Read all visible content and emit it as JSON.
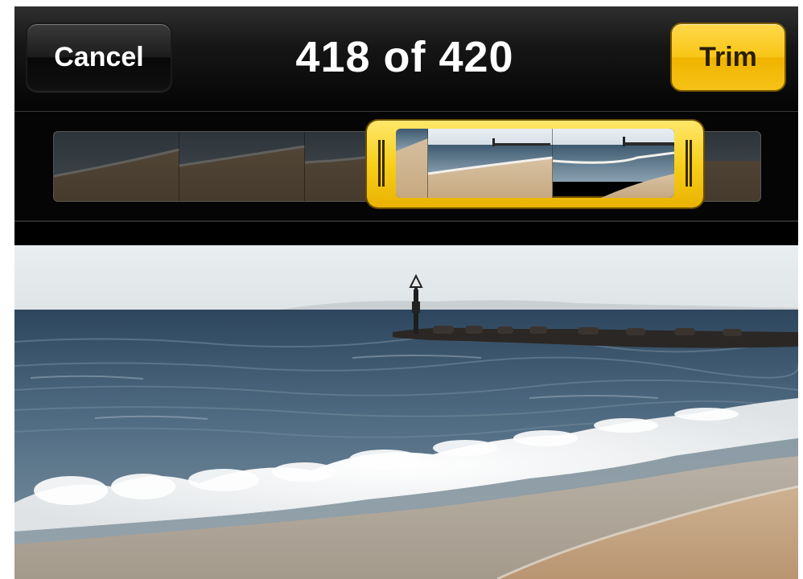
{
  "toolbar": {
    "cancel_label": "Cancel",
    "title": "418 of 420",
    "trim_label": "Trim"
  },
  "colors": {
    "trim_accent": "#f7c51a",
    "toolbar_bg": "#0a0a0a"
  },
  "icons": {
    "left_handle": "trim-handle-left-icon",
    "right_handle": "trim-handle-right-icon"
  }
}
